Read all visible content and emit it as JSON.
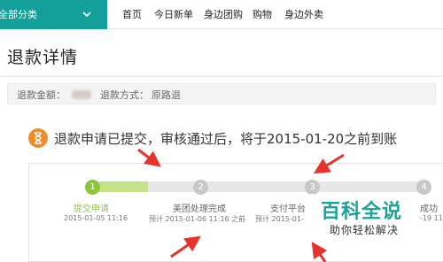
{
  "topnav": {
    "category_label": "全部分类",
    "items": [
      "首页",
      "今日新单",
      "身边团购",
      "购物",
      "身边外卖"
    ]
  },
  "page": {
    "title": "退款详情"
  },
  "info": {
    "amount_label": "退款金额：",
    "method_label": "退款方式：",
    "method_value": "原路退"
  },
  "status": {
    "text": "退款申请已提交，审核通过后，将于2015-01-20之前到账"
  },
  "steps": [
    {
      "number": "1",
      "label": "提交申请",
      "time": "2015-01-05 11:16",
      "state": "done"
    },
    {
      "number": "2",
      "label": "美团处理完成",
      "time": "预计 2015-01-06 11:16 之前",
      "state": "pending"
    },
    {
      "number": "3",
      "label": "支付平台",
      "time": "预计 2015-01-",
      "state": "pending"
    },
    {
      "number": "4",
      "label": "成功",
      "time": "-19 11",
      "state": "pending"
    }
  ],
  "watermark": {
    "title": "百科全说",
    "subtitle": "助你轻松解决"
  },
  "colors": {
    "brand": "#14a09a",
    "step_done": "#8cc63f",
    "step_todo": "#c8c8c8",
    "status_icon": "#f08c2b",
    "arrow": "#e8322e",
    "watermark": "#19a29c"
  }
}
